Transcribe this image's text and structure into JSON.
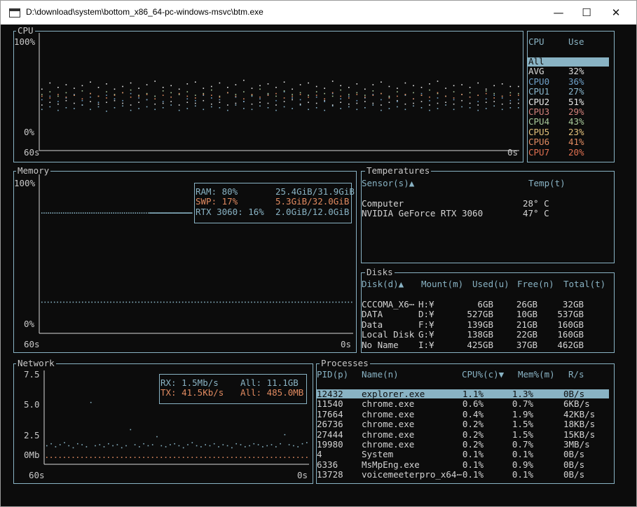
{
  "window": {
    "title": "D:\\download\\system\\bottom_x86_64-pc-windows-msvc\\btm.exe",
    "minimize_glyph": "—",
    "maximize_glyph": "☐",
    "close_glyph": "✕"
  },
  "cpu": {
    "title": "CPU",
    "y_max": "100%",
    "y_min": "0%",
    "x_left": "60s",
    "x_right": "0s",
    "legend_headers": [
      "CPU",
      "Use"
    ],
    "legend": [
      {
        "name": "All",
        "use": "",
        "color": "#0c0c0c"
      },
      {
        "name": "AVG",
        "use": "32%",
        "color": "#dcdcdc"
      },
      {
        "name": "CPU0",
        "use": "36%",
        "color": "#6fa0c8"
      },
      {
        "name": "CPU1",
        "use": "27%",
        "color": "#88b5cc"
      },
      {
        "name": "CPU2",
        "use": "51%",
        "color": "#e8e8e8"
      },
      {
        "name": "CPU3",
        "use": "29%",
        "color": "#d0807a"
      },
      {
        "name": "CPU4",
        "use": "43%",
        "color": "#a8c89a"
      },
      {
        "name": "CPU5",
        "use": "23%",
        "color": "#e3c07a"
      },
      {
        "name": "CPU6",
        "use": "41%",
        "color": "#e08a60"
      },
      {
        "name": "CPU7",
        "use": "20%",
        "color": "#e07050"
      }
    ]
  },
  "memory": {
    "title": "Memory",
    "y_max": "100%",
    "y_min": "0%",
    "x_left": "60s",
    "x_right": "0s",
    "legend": [
      {
        "label": "RAM: 80%",
        "value": "25.4GiB/31.9GiB",
        "color": "#89b3c4"
      },
      {
        "label": "SWP: 17%",
        "value": "5.3GiB/32.0GiB",
        "color": "#e08a60"
      },
      {
        "label": "RTX 3060: 16%",
        "value": "2.0GiB/12.0GiB",
        "color": "#89b3c4"
      }
    ]
  },
  "temperatures": {
    "title": "Temperatures",
    "headers": [
      "Sensor(s)▲",
      "Temp(t)"
    ],
    "rows": [
      {
        "sensor": "Computer",
        "temp": "28° C"
      },
      {
        "sensor": "NVIDIA GeForce RTX 3060",
        "temp": "47° C"
      }
    ]
  },
  "disks": {
    "title": "Disks",
    "headers": [
      "Disk(d)▲",
      "Mount(m)",
      "Used(u)",
      "Free(n)",
      "Total(t)"
    ],
    "rows": [
      {
        "disk": "CCCOMA_X6⋯",
        "mount": "H:¥",
        "used": "6GB",
        "free": "26GB",
        "total": "32GB"
      },
      {
        "disk": "DATA",
        "mount": "D:¥",
        "used": "527GB",
        "free": "10GB",
        "total": "537GB"
      },
      {
        "disk": "Data",
        "mount": "F:¥",
        "used": "139GB",
        "free": "21GB",
        "total": "160GB"
      },
      {
        "disk": "Local Disk",
        "mount": "G:¥",
        "used": "138GB",
        "free": "22GB",
        "total": "160GB"
      },
      {
        "disk": "No Name",
        "mount": "I:¥",
        "used": "425GB",
        "free": "37GB",
        "total": "462GB"
      }
    ]
  },
  "network": {
    "title": "Network",
    "y_ticks": [
      "7.5",
      "5.0",
      "2.5",
      "0Mb"
    ],
    "x_left": "60s",
    "x_right": "0s",
    "legend": [
      {
        "label": "RX: 1.5Mb/s",
        "all": "All: 11.1GB",
        "color": "#89b3c4"
      },
      {
        "label": "TX: 41.5Kb/s",
        "all": "All: 485.0MB",
        "color": "#e08a60"
      }
    ]
  },
  "processes": {
    "title": "Processes",
    "headers": [
      "PID(p)",
      "Name(n)",
      "CPU%(c)▼",
      "Mem%(m)",
      "R/s"
    ],
    "rows": [
      {
        "pid": "12432",
        "name": "explorer.exe",
        "cpu": "1.1%",
        "mem": "1.3%",
        "rs": "0B/s"
      },
      {
        "pid": "11540",
        "name": "chrome.exe",
        "cpu": "0.6%",
        "mem": "0.7%",
        "rs": "6KB/s"
      },
      {
        "pid": "17664",
        "name": "chrome.exe",
        "cpu": "0.4%",
        "mem": "1.9%",
        "rs": "42KB/s"
      },
      {
        "pid": "26736",
        "name": "chrome.exe",
        "cpu": "0.2%",
        "mem": "1.5%",
        "rs": "18KB/s"
      },
      {
        "pid": "27444",
        "name": "chrome.exe",
        "cpu": "0.2%",
        "mem": "1.5%",
        "rs": "15KB/s"
      },
      {
        "pid": "19980",
        "name": "chrome.exe",
        "cpu": "0.2%",
        "mem": "0.7%",
        "rs": "3MB/s"
      },
      {
        "pid": "4",
        "name": "System",
        "cpu": "0.1%",
        "mem": "0.1%",
        "rs": "0B/s"
      },
      {
        "pid": "6336",
        "name": "MsMpEng.exe",
        "cpu": "0.1%",
        "mem": "0.9%",
        "rs": "0B/s"
      },
      {
        "pid": "13728",
        "name": "voicemeeterpro_x64⋯",
        "cpu": "0.1%",
        "mem": "0.1%",
        "rs": "0B/s"
      }
    ]
  },
  "chart_data": [
    {
      "type": "line",
      "title": "CPU",
      "x_range": [
        60,
        0
      ],
      "ylim": [
        0,
        100
      ],
      "series": [
        {
          "name": "AVG",
          "values": [
            30,
            33,
            31,
            35,
            32,
            30,
            34,
            31,
            33,
            35,
            32,
            30,
            33,
            36,
            31,
            32,
            34,
            30,
            33,
            32,
            35,
            31,
            33,
            30,
            32,
            34,
            31,
            33,
            32,
            30,
            34,
            36,
            31,
            33,
            32,
            35,
            30,
            33,
            31,
            32,
            34,
            32,
            30,
            33,
            35,
            31,
            32,
            34,
            30,
            32,
            33,
            31,
            35,
            32,
            30,
            33,
            34,
            31,
            32,
            32
          ]
        },
        {
          "name": "CPU0",
          "values": [
            36,
            40,
            34,
            38,
            42,
            35,
            39,
            33,
            41,
            37,
            35,
            43,
            38,
            36,
            40,
            34,
            39,
            42,
            37,
            35,
            41,
            38,
            36,
            44,
            39,
            34,
            40,
            37,
            42,
            35,
            45,
            38,
            36,
            41,
            39,
            34,
            43,
            37,
            40,
            35,
            38,
            42,
            36,
            39,
            34,
            41,
            37,
            43,
            35,
            38,
            40,
            36,
            42,
            39,
            34,
            37,
            41,
            38,
            35,
            36
          ]
        },
        {
          "name": "CPU1",
          "values": [
            25,
            28,
            24,
            27,
            26,
            30,
            25,
            28,
            23,
            27,
            29,
            24,
            26,
            28,
            25,
            27,
            30,
            24,
            26,
            29,
            25,
            28,
            27,
            24,
            30,
            26,
            25,
            29,
            27,
            24,
            28,
            26,
            30,
            25,
            27,
            24,
            29,
            26,
            28,
            25,
            27,
            30,
            24,
            26,
            28,
            25,
            29,
            27,
            24,
            26,
            30,
            25,
            28,
            27,
            24,
            26,
            29,
            25,
            27,
            27
          ]
        },
        {
          "name": "CPU2",
          "values": [
            48,
            55,
            50,
            53,
            49,
            52,
            56,
            50,
            54,
            48,
            51,
            55,
            49,
            53,
            57,
            50,
            52,
            48,
            54,
            56,
            49,
            51,
            55,
            50,
            53,
            58,
            49,
            52,
            54,
            50,
            56,
            48,
            53,
            55,
            51,
            49,
            57,
            52,
            50,
            54,
            48,
            53,
            56,
            51,
            49,
            55,
            52,
            50,
            54,
            57,
            49,
            52,
            53,
            50,
            55,
            48,
            52,
            54,
            51,
            51
          ]
        },
        {
          "name": "CPU4",
          "values": [
            42,
            45,
            40,
            44,
            41,
            46,
            43,
            40,
            45,
            42,
            44,
            47,
            41,
            43,
            40,
            46,
            44,
            42,
            45,
            41,
            43,
            47,
            40,
            44,
            42,
            45,
            41,
            48,
            43,
            40,
            46,
            42,
            44,
            41,
            45,
            43,
            40,
            47,
            42,
            44,
            41,
            46,
            43,
            40,
            45,
            42,
            44,
            41,
            47,
            43,
            40,
            45,
            42,
            44,
            41,
            46,
            43,
            40,
            44,
            43
          ]
        },
        {
          "name": "CPU6",
          "values": [
            40,
            38,
            42,
            39,
            41,
            37,
            43,
            40,
            38,
            41,
            44,
            39,
            40,
            42,
            37,
            41,
            39,
            43,
            40,
            38,
            42,
            41,
            39,
            44,
            40,
            37,
            42,
            39,
            41,
            43,
            38,
            40,
            42,
            39,
            41,
            37,
            44,
            40,
            38,
            42,
            39,
            41,
            43,
            38,
            40,
            42,
            37,
            41,
            39,
            44,
            40,
            38,
            42,
            39,
            41,
            43,
            38,
            40,
            41,
            41
          ]
        }
      ]
    },
    {
      "type": "line",
      "title": "Memory",
      "x_range": [
        60,
        0
      ],
      "ylim": [
        0,
        100
      ],
      "series": [
        {
          "name": "RAM",
          "values": [
            79,
            79,
            79,
            79,
            79,
            79,
            79,
            79,
            79,
            79,
            79,
            79,
            79,
            79,
            79,
            79,
            79,
            79,
            79,
            79,
            79,
            79,
            79,
            79,
            79,
            79,
            79,
            79,
            79,
            79,
            79,
            79,
            79,
            79,
            79,
            79,
            79,
            79,
            79,
            79,
            79,
            79,
            79,
            79,
            79,
            79,
            79,
            79,
            79,
            79,
            79,
            79,
            79,
            79,
            79,
            79,
            79,
            79,
            79,
            79,
            79,
            79,
            79,
            79,
            79,
            79,
            79,
            79,
            79,
            79,
            79,
            79,
            79,
            79,
            79,
            79,
            79,
            79,
            79,
            79,
            79,
            79,
            79,
            79,
            79,
            79,
            79,
            79,
            79,
            79,
            79,
            79,
            79,
            79,
            79,
            79,
            79,
            79,
            79,
            79
          ]
        },
        {
          "name": "SWP",
          "values": [
            17,
            17,
            17,
            17,
            17,
            17,
            17,
            17,
            17,
            17,
            17,
            17,
            17,
            17,
            17,
            17,
            17,
            17,
            17,
            17,
            17,
            17,
            17,
            17,
            17,
            17,
            17,
            17,
            17,
            17,
            17,
            17,
            17,
            17,
            17,
            17,
            17,
            17,
            17,
            17,
            17,
            17,
            17,
            17,
            17,
            17,
            17,
            17,
            17,
            17,
            17,
            17,
            17,
            17,
            17,
            17,
            17,
            17,
            17,
            17,
            17,
            17,
            17,
            17,
            17,
            17,
            17,
            17,
            17,
            17,
            17,
            17,
            17,
            17,
            17,
            17,
            17,
            17,
            17,
            17,
            17,
            17,
            17,
            17,
            17,
            17,
            17,
            17,
            17,
            17,
            17,
            17,
            17,
            17,
            17,
            17,
            17,
            17,
            17,
            17
          ]
        },
        {
          "name": "RTX 3060",
          "values": [
            16,
            16,
            16,
            16,
            16,
            16,
            16,
            16,
            16,
            16,
            16,
            16,
            16,
            16,
            16,
            16,
            16,
            16,
            16,
            16,
            16,
            16,
            16,
            16,
            16,
            16,
            16,
            16,
            16,
            16,
            16,
            16,
            16,
            16,
            16,
            16,
            16,
            16,
            16,
            16,
            16,
            16,
            16,
            16,
            16,
            16,
            16,
            16,
            16,
            16,
            16,
            16,
            16,
            16,
            16,
            16,
            16,
            16,
            16,
            16,
            16,
            16,
            16,
            16,
            16,
            16,
            16,
            16,
            16,
            16,
            16,
            16,
            16,
            16,
            16,
            16,
            16,
            16,
            16,
            16,
            16,
            16,
            16,
            16,
            16,
            16,
            16,
            16,
            16,
            16,
            16,
            16,
            16,
            16,
            16,
            16,
            16,
            16,
            16,
            16
          ]
        }
      ]
    },
    {
      "type": "line",
      "title": "Network",
      "x_range": [
        60,
        0
      ],
      "ylim": [
        0,
        8.2
      ],
      "y_ticks": [
        7.5,
        5.0,
        2.5,
        0
      ],
      "series": [
        {
          "name": "RX",
          "values": [
            1.2,
            1.4,
            1.1,
            1.3,
            1.5,
            1.2,
            1.0,
            1.4,
            1.3,
            1.1,
            5.5,
            1.2,
            1.3,
            1.1,
            1.4,
            1.2,
            1.3,
            1.0,
            1.2,
            2.8,
            1.3,
            1.1,
            1.4,
            1.2,
            1.3,
            2.1,
            1.2,
            1.1,
            1.3,
            1.4,
            1.2,
            1.0,
            1.3,
            1.5,
            1.2,
            1.1,
            1.3,
            1.2,
            1.4,
            1.1,
            1.3,
            1.2,
            1.0,
            1.4,
            1.3,
            1.1,
            1.2,
            1.4,
            1.3,
            1.1,
            1.2,
            1.3,
            1.1,
            1.4,
            2.3,
            1.3,
            1.2,
            1.1,
            1.4,
            1.5
          ]
        },
        {
          "name": "TX",
          "values": [
            0.04,
            0.04,
            0.04,
            0.04,
            0.04,
            0.04,
            0.04,
            0.04,
            0.04,
            0.04,
            0.04,
            0.04,
            0.04,
            0.04,
            0.04,
            0.04,
            0.04,
            0.04,
            0.04,
            0.04,
            0.04,
            0.04,
            0.04,
            0.04,
            0.04,
            0.04,
            0.04,
            0.04,
            0.04,
            0.04,
            0.04,
            0.04,
            0.04,
            0.04,
            0.04,
            0.04,
            0.04,
            0.04,
            0.04,
            0.04,
            0.04,
            0.04,
            0.04,
            0.04,
            0.04,
            0.04,
            0.04,
            0.04,
            0.04,
            0.04,
            0.04,
            0.04,
            0.04,
            0.04,
            0.04,
            0.04,
            0.04,
            0.04,
            0.04,
            0.04
          ]
        }
      ]
    }
  ]
}
